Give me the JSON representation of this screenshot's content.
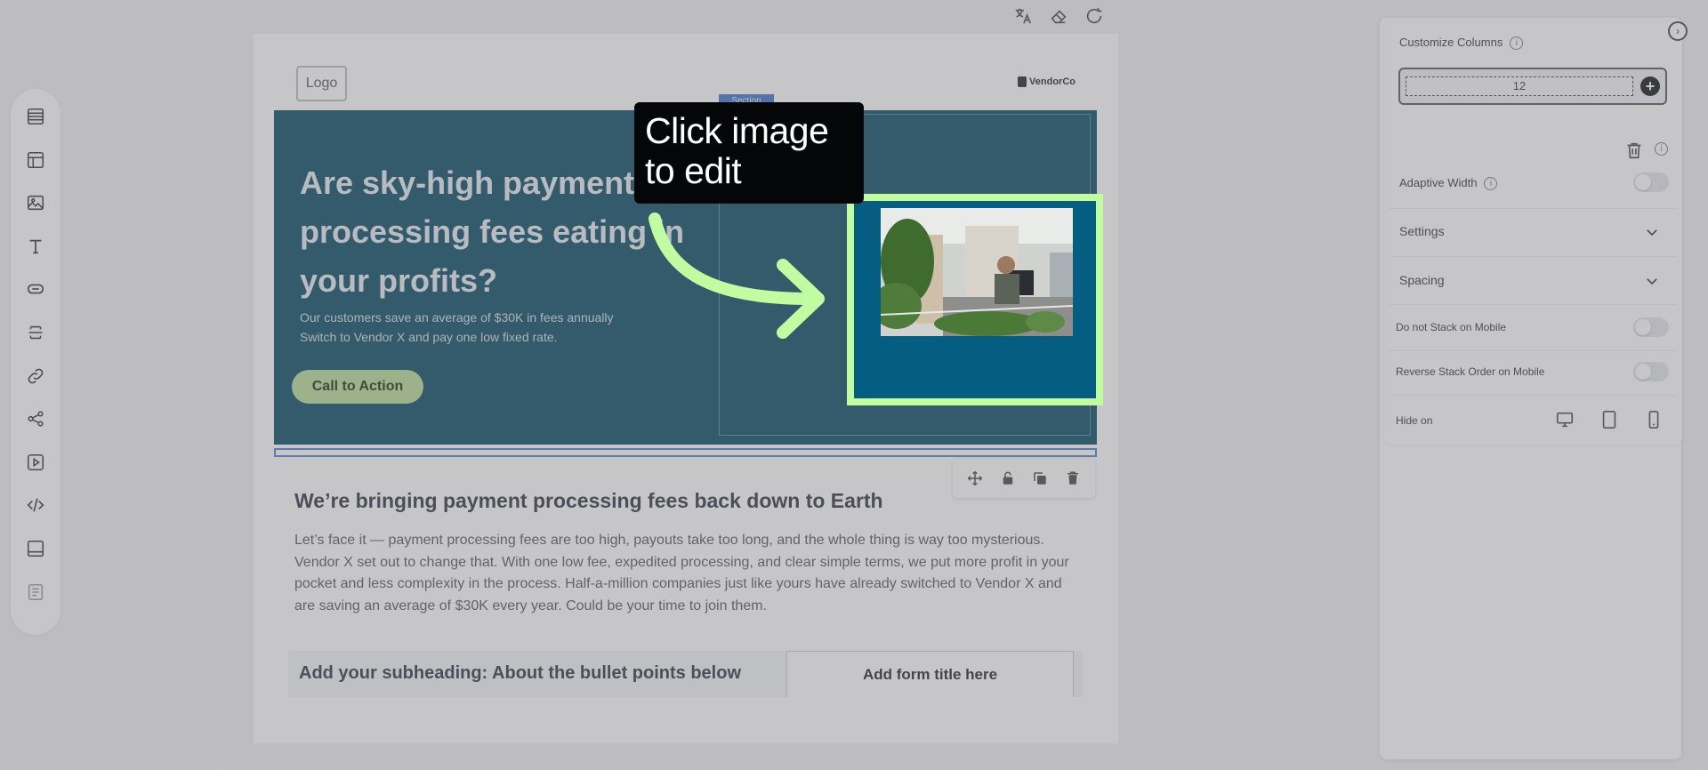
{
  "canvas": {
    "logo_label": "Logo",
    "vendor_logo": "VendorCo",
    "section_tag": "Section",
    "hero": {
      "title": "Are sky-high payment processing fees eating in your profits?",
      "subtitle_line1": "Our customers save an average of $30K in fees annually",
      "subtitle_line2": "Switch to Vendor X and pay one low fixed rate.",
      "cta_label": "Call to Action"
    },
    "body": {
      "title": "We’re bringing payment processing fees back down to Earth",
      "text": "Let’s face it — payment processing fees are too high, payouts take too long, and the whole thing is way too mysterious. Vendor X set out to change that. With one low fee, expedited processing, and clear simple terms, we put more profit in your pocket and less complexity in the process. Half-a-million companies just like yours have already switched to Vendor X and are saving an average of $30K every year. Could be your time to join them.",
      "subheading": "Add your subheading: About the bullet points below",
      "form_title": "Add form title here"
    }
  },
  "overlay": {
    "tooltip": "Click image to edit",
    "highlight_color": "#c2fca0"
  },
  "right_panel": {
    "customize_columns_label": "Customize Columns",
    "columns_value": "12",
    "adaptive_width_label": "Adaptive Width",
    "settings_label": "Settings",
    "spacing_label": "Spacing",
    "no_stack_label": "Do not Stack on Mobile",
    "reverse_stack_label": "Reverse Stack Order on Mobile",
    "hide_on_label": "Hide on"
  },
  "colors": {
    "hero_bg": "#04485f",
    "cta_bg": "#b6dc96",
    "accent": "#3b73c7"
  }
}
